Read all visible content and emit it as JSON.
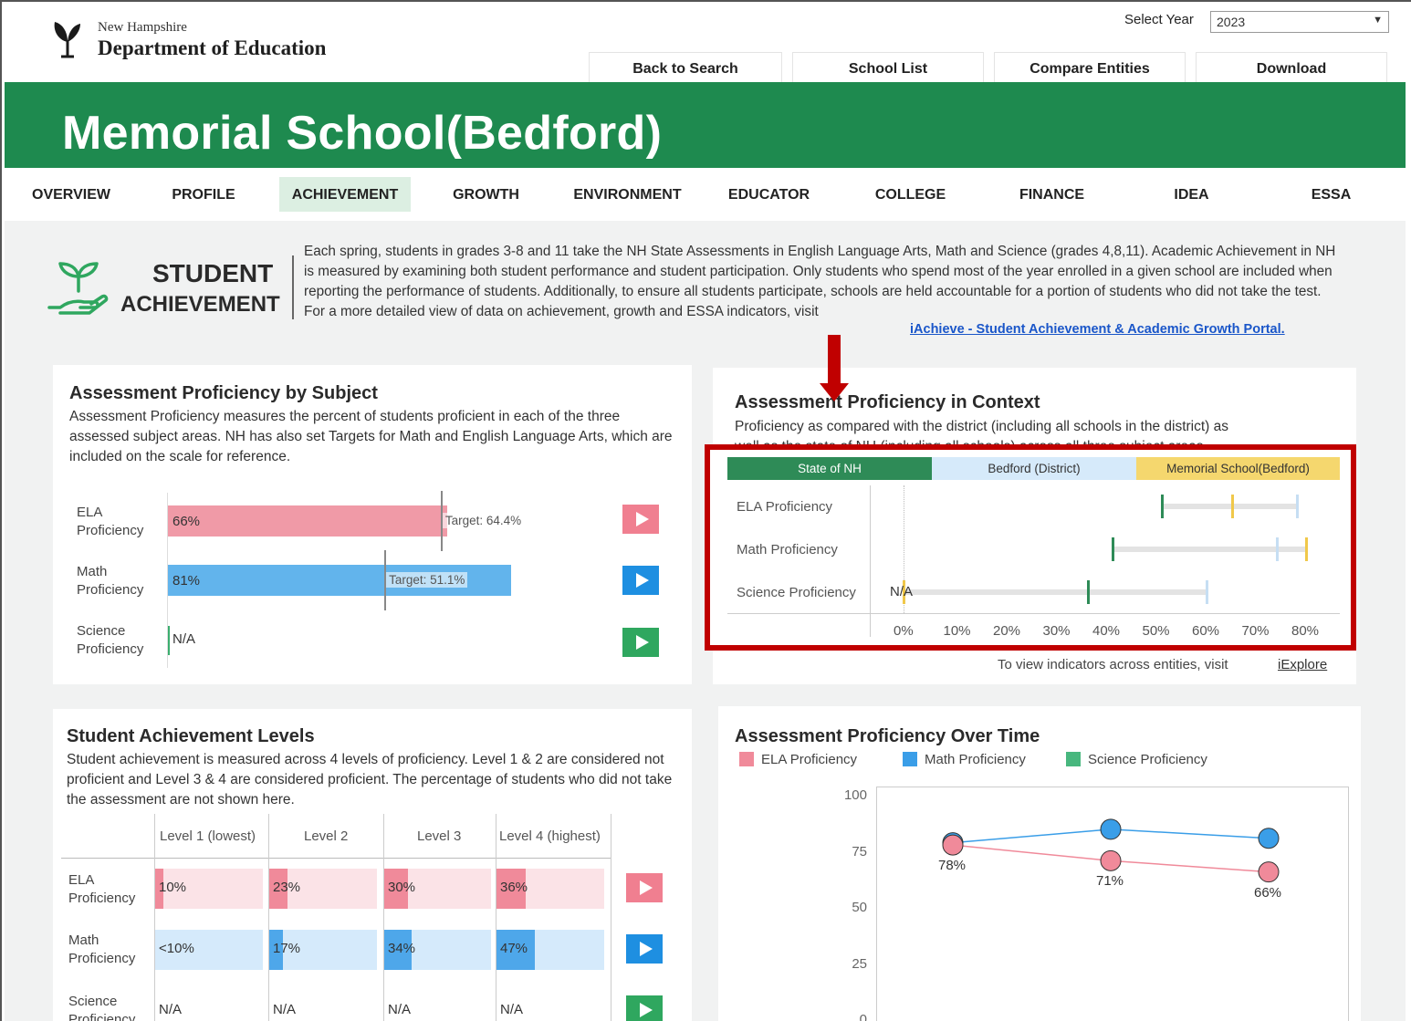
{
  "header": {
    "org_small": "New Hampshire",
    "org_big": "Department of Education",
    "select_year_label": "Select Year",
    "select_year_value": "2023",
    "buttons": [
      "Back to Search",
      "School List",
      "Compare Entities",
      "Download"
    ]
  },
  "banner": {
    "school_name": "Memorial School(Bedford)"
  },
  "tabs": [
    "OVERVIEW",
    "PROFILE",
    "ACHIEVEMENT",
    "GROWTH",
    "ENVIRONMENT",
    "EDUCATOR",
    "COLLEGE",
    "FINANCE",
    "IDEA",
    "ESSA"
  ],
  "active_tab": "ACHIEVEMENT",
  "intro": {
    "title_line1": "STUDENT",
    "title_line2": "ACHIEVEMENT",
    "text": "Each spring, students in grades 3-8 and 11 take the NH State Assessments in English Language Arts, Math and Science (grades 4,8,11). Academic Achievement in NH is measured by examining both student performance and student participation. Only students who spend most of the year enrolled in a given school are included when reporting the performance of students. Additionally, to ensure all students participate, schools are held accountable for a portion of students who did not take the test.",
    "link_prefix": "For a more detailed view of data on achievement, growth and ESSA indicators, visit",
    "link_text": "iAchieve - Student Achievement & Academic Growth Portal."
  },
  "by_subject": {
    "title": "Assessment Proficiency by Subject",
    "desc": "Assessment Proficiency measures the percent of students proficient in each of the three assessed subject areas. NH has also set Targets for Math and English Language Arts, which are included on the scale for reference.",
    "rows": [
      {
        "label1": "ELA",
        "label2": "Proficiency",
        "value_text": "66%",
        "value": 66,
        "target_text": "Target: 64.4%",
        "target": 64.4,
        "color": "#f09aa7"
      },
      {
        "label1": "Math",
        "label2": "Proficiency",
        "value_text": "81%",
        "value": 81,
        "target_text": "Target: 51.1%",
        "target": 51.1,
        "color": "#62b4ec"
      },
      {
        "label1": "Science",
        "label2": "Proficiency",
        "value_text": "N/A",
        "value": null,
        "target_text": "",
        "target": null,
        "color": "#3aae6e"
      }
    ],
    "play_colors": [
      "#f07f90",
      "#1e8fe1",
      "#2fa75f"
    ]
  },
  "in_context": {
    "title": "Assessment Proficiency in Context",
    "desc_line1": "Proficiency as compared with the district (including all schools in the district) as",
    "desc_line2": "well as the state of NH (including all schools) across all three subject areas.",
    "legend": [
      {
        "label": "State of NH",
        "bg": "#2e8b57",
        "fg": "#ffffff"
      },
      {
        "label": "Bedford (District)",
        "bg": "#d6eafa",
        "fg": "#333333"
      },
      {
        "label": "Memorial School(Bedford)",
        "bg": "#f5d76e",
        "fg": "#333333"
      }
    ],
    "rows": [
      "ELA Proficiency",
      "Math Proficiency",
      "Science Proficiency"
    ],
    "na_text": "N/A",
    "ticks": [
      "0%",
      "10%",
      "20%",
      "30%",
      "40%",
      "50%",
      "60%",
      "70%",
      "80%"
    ],
    "footer_text": "To view indicators across entities, visit",
    "footer_link": "iExplore"
  },
  "chart_data": [
    {
      "type": "bar",
      "title": "Assessment Proficiency by Subject",
      "categories": [
        "ELA Proficiency",
        "Math Proficiency",
        "Science Proficiency"
      ],
      "values": [
        66,
        81,
        null
      ],
      "targets": [
        64.4,
        51.1,
        null
      ]
    },
    {
      "type": "scatter",
      "title": "Assessment Proficiency in Context",
      "categories": [
        "ELA Proficiency",
        "Math Proficiency",
        "Science Proficiency"
      ],
      "xlim": [
        0,
        80
      ],
      "series": [
        {
          "name": "State of NH",
          "values": [
            52,
            42,
            37
          ]
        },
        {
          "name": "Bedford (District)",
          "values": [
            79,
            75,
            61
          ]
        },
        {
          "name": "Memorial School(Bedford)",
          "values": [
            66,
            81,
            null
          ]
        }
      ]
    },
    {
      "type": "line",
      "title": "Assessment Proficiency Over Time",
      "ylim": [
        0,
        100
      ],
      "yticks": [
        0,
        25,
        50,
        75,
        100
      ],
      "series": [
        {
          "name": "ELA Proficiency",
          "values": [
            78,
            71,
            66
          ],
          "labels": [
            "78%",
            "71%",
            "66%"
          ]
        },
        {
          "name": "Math Proficiency",
          "values": [
            79,
            85,
            81
          ]
        }
      ]
    }
  ],
  "levels": {
    "title": "Student Achievement Levels",
    "desc": "Student achievement is measured across 4 levels of proficiency. Level 1 & 2 are considered not proficient and Level 3 & 4 are considered proficient. The percentage of students who did not take the assessment are not shown here.",
    "headers": [
      "Level 1 (lowest)",
      "Level 2",
      "Level 3",
      "Level 4 (highest)"
    ],
    "rows": [
      {
        "label1": "ELA",
        "label2": "Proficiency",
        "cells": [
          "10%",
          "23%",
          "30%",
          "36%"
        ],
        "fills": [
          0.1,
          0.23,
          0.3,
          0.36
        ],
        "bg": "#fbe3e7",
        "fg": "#f08a9a"
      },
      {
        "label1": "Math",
        "label2": "Proficiency",
        "cells": [
          "<10%",
          "17%",
          "34%",
          "47%"
        ],
        "fills": [
          0,
          0.17,
          0.34,
          0.47
        ],
        "bg": "#d5eafb",
        "fg": "#4ea7ea"
      },
      {
        "label1": "Science",
        "label2": "Proficiency",
        "cells": [
          "N/A",
          "N/A",
          "N/A",
          "N/A"
        ],
        "fills": [
          0,
          0,
          0,
          0
        ],
        "bg": "#ffffff",
        "fg": "#ffffff"
      }
    ]
  },
  "over_time": {
    "title": "Assessment Proficiency Over Time",
    "legend": [
      {
        "label": "ELA Proficiency",
        "color": "#f08a9a"
      },
      {
        "label": "Math Proficiency",
        "color": "#3a9ee8"
      },
      {
        "label": "Science Proficiency",
        "color": "#48b77e"
      }
    ]
  }
}
